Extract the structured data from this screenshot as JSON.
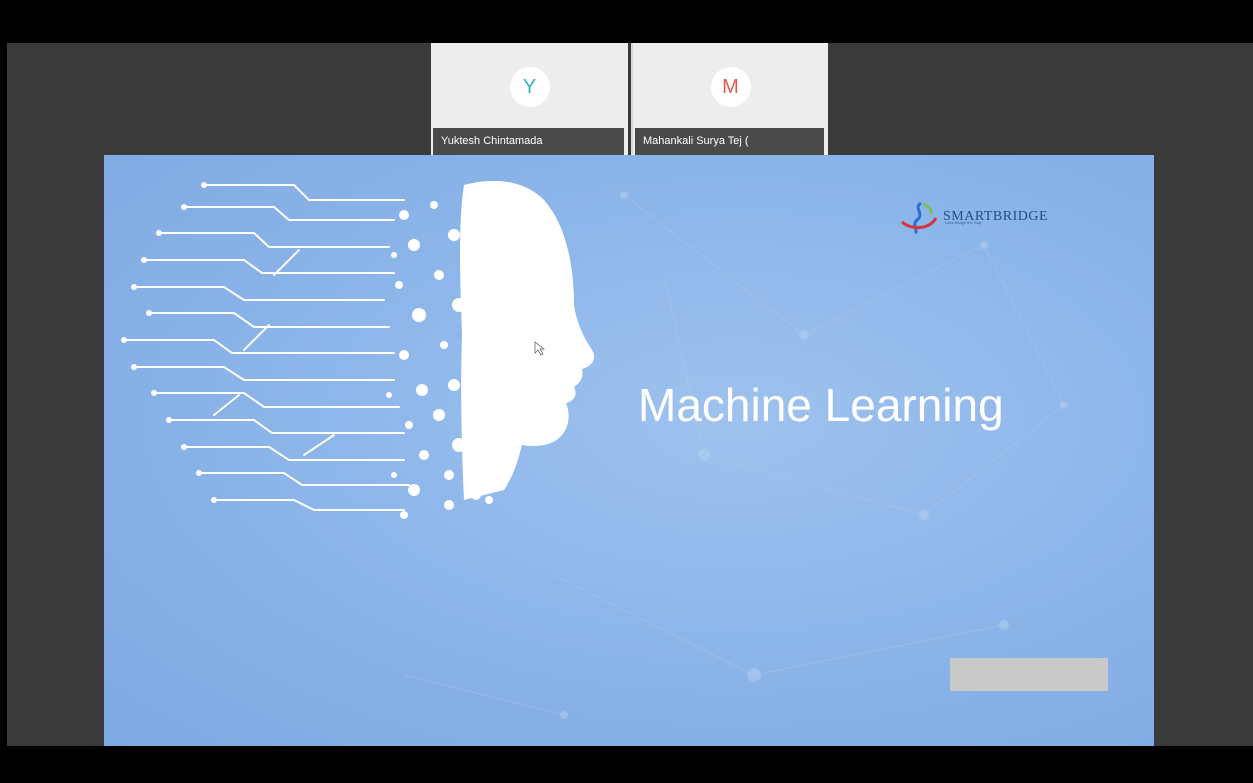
{
  "participants": [
    {
      "initial": "Y",
      "name": "Yuktesh Chintamada",
      "avatar_color": "#3bb3b3"
    },
    {
      "initial": "M",
      "name": "Mahankali Surya Tej (",
      "avatar_color": "#e25a4a"
    }
  ],
  "slide": {
    "title": "Machine Learning",
    "brand": "SMARTBRIDGE",
    "brand_tagline": "Let's Bridge the Gap",
    "background_color": "#8db6ea"
  },
  "icons": {
    "face": "ai-head-circuit-icon",
    "logo": "smartbridge-logo-icon",
    "cursor": "mouse-pointer-icon"
  }
}
